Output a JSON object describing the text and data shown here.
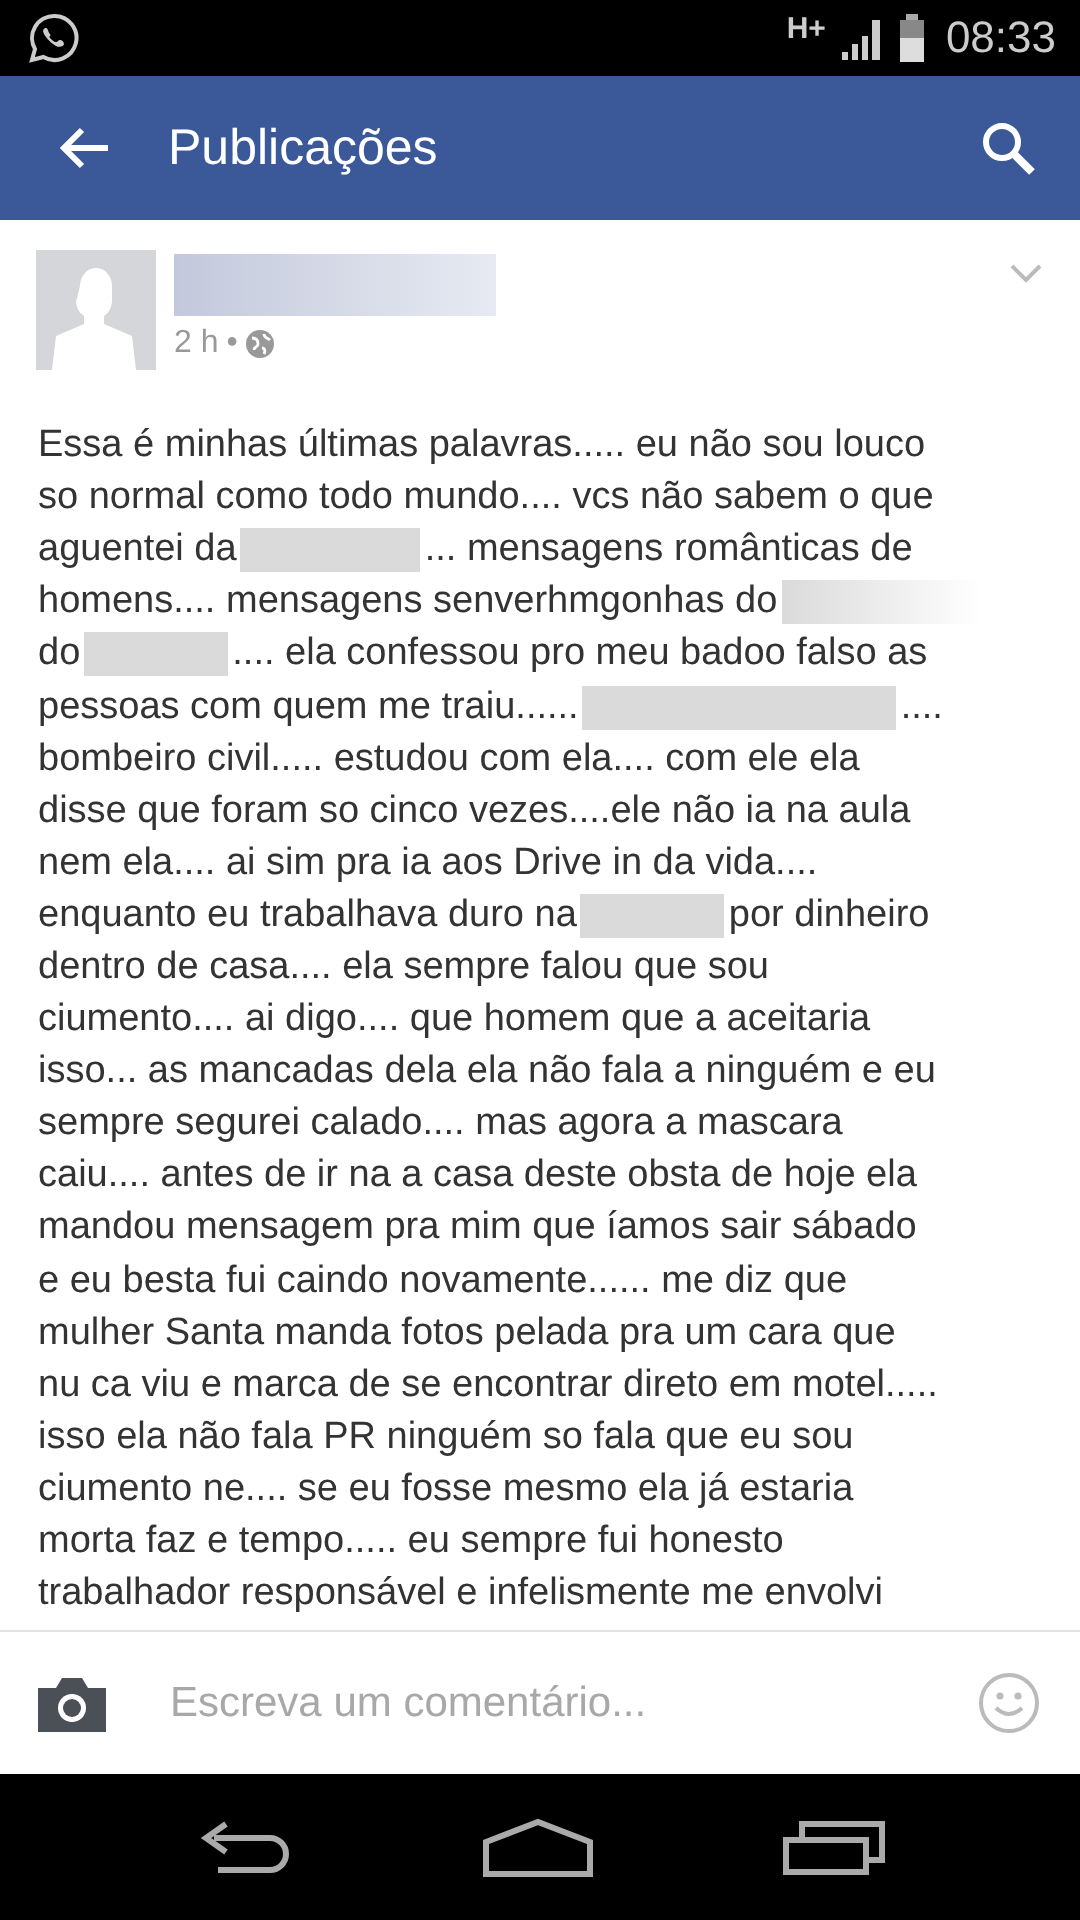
{
  "status_bar": {
    "network": "H+",
    "time": "08:33"
  },
  "app_bar": {
    "title": "Publicações"
  },
  "post": {
    "author": {
      "kind": "redacted"
    },
    "time": "2 h",
    "separator": "•",
    "lines": [
      {
        "segments": [
          {
            "kind": "text",
            "text": "Essa é minhas últimas palavras..... eu não sou louco"
          }
        ]
      },
      {
        "segments": [
          {
            "kind": "text",
            "text": "so normal como todo mundo.... vcs não sabem o que"
          }
        ]
      },
      {
        "segments": [
          {
            "kind": "text",
            "text": "aguentei da"
          },
          {
            "kind": "redacted"
          },
          {
            "kind": "text",
            "text": "... mensagens românticas de"
          }
        ]
      },
      {
        "segments": [
          {
            "kind": "text",
            "text": "homens.... mensagens senverhmgonhas do"
          },
          {
            "kind": "redacted"
          }
        ]
      },
      {
        "segments": [
          {
            "kind": "text",
            "text": "do"
          },
          {
            "kind": "redacted"
          },
          {
            "kind": "text",
            "text": ".... ela confessou pro meu badoo falso as"
          }
        ]
      },
      {
        "segments": [
          {
            "kind": "text",
            "text": "pessoas com quem me traiu......"
          },
          {
            "kind": "redacted"
          },
          {
            "kind": "text",
            "text": "...."
          }
        ]
      },
      {
        "segments": [
          {
            "kind": "text",
            "text": "bombeiro civil..... estudou com ela.... com ele ela"
          }
        ]
      },
      {
        "segments": [
          {
            "kind": "text",
            "text": "disse que foram so cinco vezes....ele não ia na aula"
          }
        ]
      },
      {
        "segments": [
          {
            "kind": "text",
            "text": "nem ela.... ai sim pra ia aos Drive in da vida...."
          }
        ]
      },
      {
        "segments": [
          {
            "kind": "text",
            "text": "enquanto eu trabalhava duro na"
          },
          {
            "kind": "redacted"
          },
          {
            "kind": "text",
            "text": "por dinheiro"
          }
        ]
      },
      {
        "segments": [
          {
            "kind": "text",
            "text": "dentro de casa.... ela sempre falou que sou"
          }
        ]
      },
      {
        "segments": [
          {
            "kind": "text",
            "text": "ciumento.... ai digo.... que homem que a aceitaria"
          }
        ]
      },
      {
        "segments": [
          {
            "kind": "text",
            "text": "isso... as mancadas dela ela não fala a ninguém e eu"
          }
        ]
      },
      {
        "segments": [
          {
            "kind": "text",
            "text": "sempre segurei calado.... mas agora a mascara"
          }
        ]
      },
      {
        "segments": [
          {
            "kind": "text",
            "text": "caiu.... antes de ir na a casa deste obsta de hoje ela"
          }
        ]
      },
      {
        "segments": [
          {
            "kind": "text",
            "text": "mandou mensagem pra mim que íamos sair sábado"
          }
        ]
      },
      {
        "segments": [
          {
            "kind": "text",
            "text": "e eu besta fui caindo novamente...... me diz que"
          }
        ]
      },
      {
        "segments": [
          {
            "kind": "text",
            "text": "mulher Santa manda fotos pelada pra um cara que"
          }
        ]
      },
      {
        "segments": [
          {
            "kind": "text",
            "text": "nu ca viu e marca de se encontrar direto em motel....."
          }
        ]
      },
      {
        "segments": [
          {
            "kind": "text",
            "text": "isso ela não fala PR ninguém so fala que eu sou"
          }
        ]
      },
      {
        "segments": [
          {
            "kind": "text",
            "text": "ciumento ne.... se eu fosse mesmo ela já estaria"
          }
        ]
      },
      {
        "segments": [
          {
            "kind": "text",
            "text": "morta faz e tempo..... eu sempre fui honesto"
          }
        ]
      },
      {
        "segments": [
          {
            "kind": "text",
            "text": "trabalhador responsável e infelismente me envolvi"
          }
        ]
      }
    ]
  },
  "comment_bar": {
    "placeholder": "Escreva um comentário..."
  }
}
